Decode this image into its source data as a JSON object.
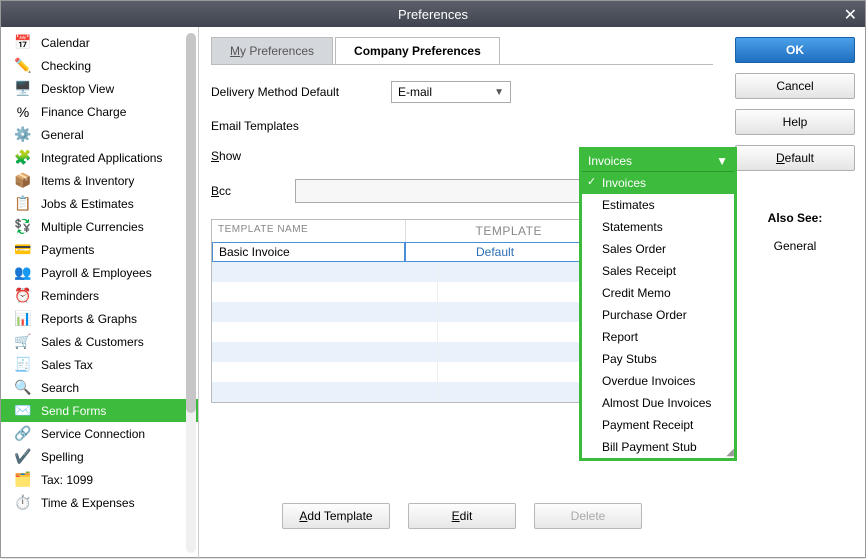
{
  "window": {
    "title": "Preferences"
  },
  "sidebar": {
    "items": [
      {
        "label": "Calendar",
        "icon": "📅",
        "iconName": "calendar-icon"
      },
      {
        "label": "Checking",
        "icon": "✏️",
        "iconName": "pencil-icon"
      },
      {
        "label": "Desktop View",
        "icon": "🖥️",
        "iconName": "desktop-icon"
      },
      {
        "label": "Finance Charge",
        "icon": "%",
        "iconName": "percent-icon"
      },
      {
        "label": "General",
        "icon": "⚙️",
        "iconName": "gear-icon"
      },
      {
        "label": "Integrated Applications",
        "icon": "🧩",
        "iconName": "puzzle-icon"
      },
      {
        "label": "Items & Inventory",
        "icon": "📦",
        "iconName": "box-icon"
      },
      {
        "label": "Jobs & Estimates",
        "icon": "📋",
        "iconName": "clipboard-icon"
      },
      {
        "label": "Multiple Currencies",
        "icon": "💱",
        "iconName": "currency-icon"
      },
      {
        "label": "Payments",
        "icon": "💳",
        "iconName": "card-icon"
      },
      {
        "label": "Payroll & Employees",
        "icon": "👥",
        "iconName": "people-icon"
      },
      {
        "label": "Reminders",
        "icon": "⏰",
        "iconName": "clock-icon"
      },
      {
        "label": "Reports & Graphs",
        "icon": "📊",
        "iconName": "chart-icon"
      },
      {
        "label": "Sales & Customers",
        "icon": "🛒",
        "iconName": "cart-icon"
      },
      {
        "label": "Sales Tax",
        "icon": "🧾",
        "iconName": "receipt-icon"
      },
      {
        "label": "Search",
        "icon": "🔍",
        "iconName": "search-icon"
      },
      {
        "label": "Send Forms",
        "icon": "✉️",
        "iconName": "envelope-icon",
        "selected": true
      },
      {
        "label": "Service Connection",
        "icon": "🔗",
        "iconName": "link-icon"
      },
      {
        "label": "Spelling",
        "icon": "✔️",
        "iconName": "check-icon"
      },
      {
        "label": "Tax: 1099",
        "icon": "🗂️",
        "iconName": "form-icon"
      },
      {
        "label": "Time & Expenses",
        "icon": "⏱️",
        "iconName": "timer-icon"
      }
    ]
  },
  "tabs": {
    "my": "My Preferences",
    "company": "Company Preferences"
  },
  "form": {
    "delivery_label": "Delivery Method Default",
    "delivery_value": "E-mail",
    "email_templates_label": "Email Templates",
    "show_label": "Show",
    "bcc_label": "Bcc",
    "bcc_value": ""
  },
  "dropdown": {
    "selected": "Invoices",
    "options": [
      "Invoices",
      "Estimates",
      "Statements",
      "Sales Order",
      "Sales Receipt",
      "Credit Memo",
      "Purchase Order",
      "Report",
      "Pay Stubs",
      "Overdue Invoices",
      "Almost Due Invoices",
      "Payment Receipt",
      "Bill Payment Stub"
    ]
  },
  "table": {
    "col1": "TEMPLATE NAME",
    "col2": "TEMPLATE",
    "row_name": "Basic Invoice",
    "row_template": "Default"
  },
  "buttons": {
    "add": "Add Template",
    "edit": "Edit",
    "delete": "Delete",
    "ok": "OK",
    "cancel": "Cancel",
    "help": "Help",
    "default": "Default"
  },
  "also_see": {
    "title": "Also See:",
    "link": "General"
  }
}
